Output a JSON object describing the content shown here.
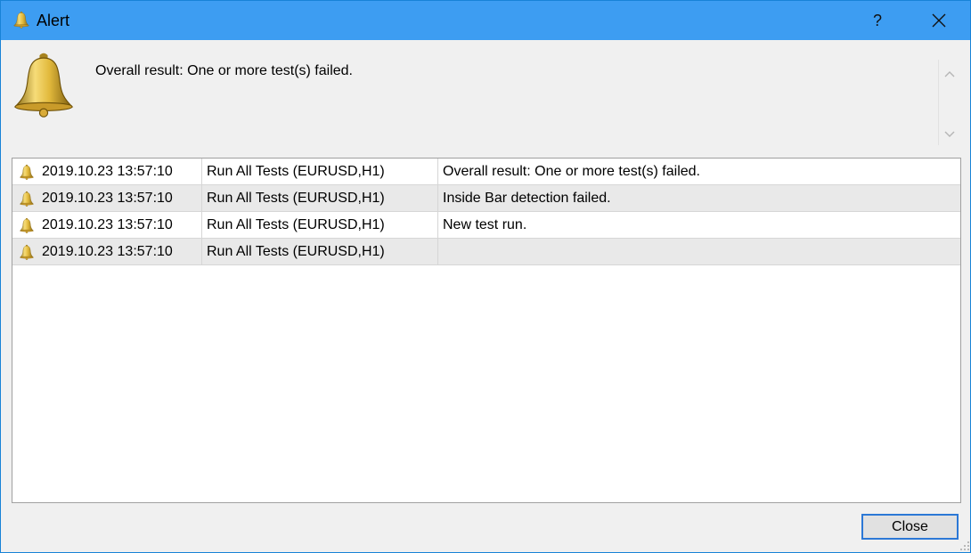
{
  "window": {
    "title": "Alert",
    "help_label": "?",
    "title_icon": "bell-icon",
    "accent_color": "#3d9df2"
  },
  "header": {
    "icon": "bell-icon",
    "message": "Overall result: One or more test(s) failed."
  },
  "alerts": [
    {
      "icon": "bell-icon",
      "time": "2019.10.23 13:57:10",
      "source": "Run All Tests (EURUSD,H1)",
      "message": "Overall result: One or more test(s) failed."
    },
    {
      "icon": "bell-icon",
      "time": "2019.10.23 13:57:10",
      "source": "Run All Tests (EURUSD,H1)",
      "message": "Inside Bar detection failed."
    },
    {
      "icon": "bell-icon",
      "time": "2019.10.23 13:57:10",
      "source": "Run All Tests (EURUSD,H1)",
      "message": "New test run."
    },
    {
      "icon": "bell-icon",
      "time": "2019.10.23 13:57:10",
      "source": "Run All Tests (EURUSD,H1)",
      "message": ""
    }
  ],
  "footer": {
    "close_label": "Close"
  }
}
